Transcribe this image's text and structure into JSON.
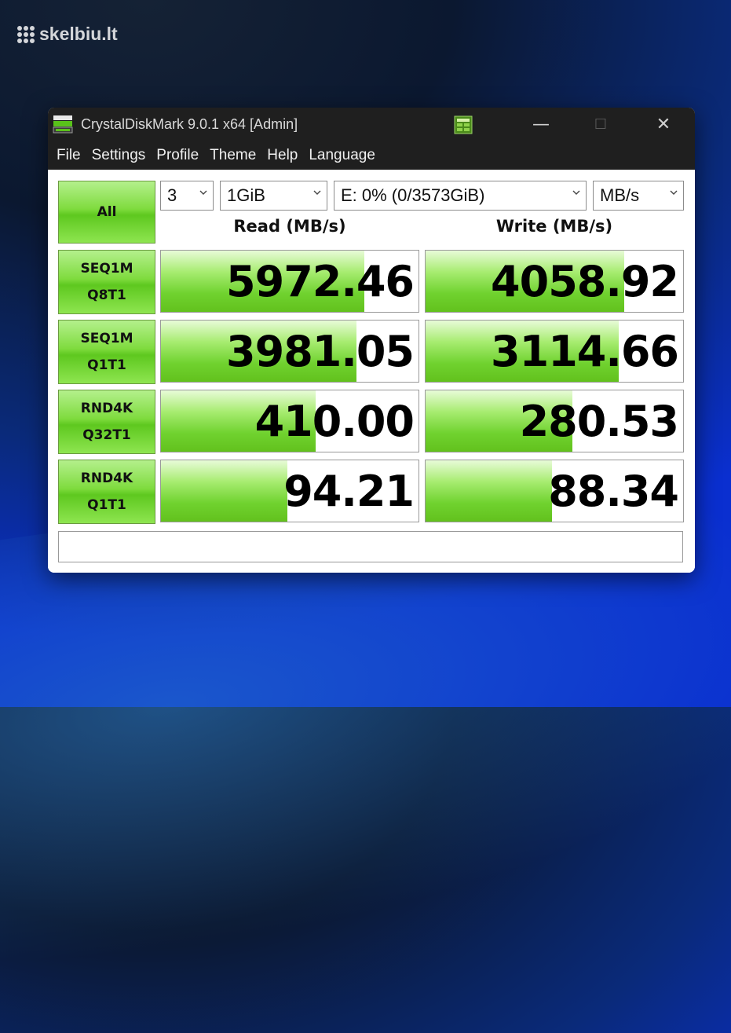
{
  "watermark": {
    "text": "skelbiu.lt"
  },
  "window": {
    "title": "CrystalDiskMark 9.0.1 x64 [Admin]",
    "controls": {
      "minimize": "—",
      "maximize": "☐",
      "close": "✕"
    }
  },
  "menu": [
    "File",
    "Settings",
    "Profile",
    "Theme",
    "Help",
    "Language"
  ],
  "controls": {
    "all_label": "All",
    "count": "3",
    "size": "1GiB",
    "drive": "E: 0% (0/3573GiB)",
    "unit": "MB/s"
  },
  "headers": {
    "read": "Read (MB/s)",
    "write": "Write (MB/s)"
  },
  "tests": [
    {
      "line1": "SEQ1M",
      "line2": "Q8T1",
      "read": "5972.46",
      "write": "4058.92",
      "read_level": 0.79,
      "write_level": 0.77
    },
    {
      "line1": "SEQ1M",
      "line2": "Q1T1",
      "read": "3981.05",
      "write": "3114.66",
      "read_level": 0.76,
      "write_level": 0.75
    },
    {
      "line1": "RND4K",
      "line2": "Q32T1",
      "read": "410.00",
      "write": "280.53",
      "read_level": 0.6,
      "write_level": 0.57
    },
    {
      "line1": "RND4K",
      "line2": "Q1T1",
      "read": "94.21",
      "write": "88.34",
      "read_level": 0.49,
      "write_level": 0.49
    }
  ],
  "comment": ""
}
